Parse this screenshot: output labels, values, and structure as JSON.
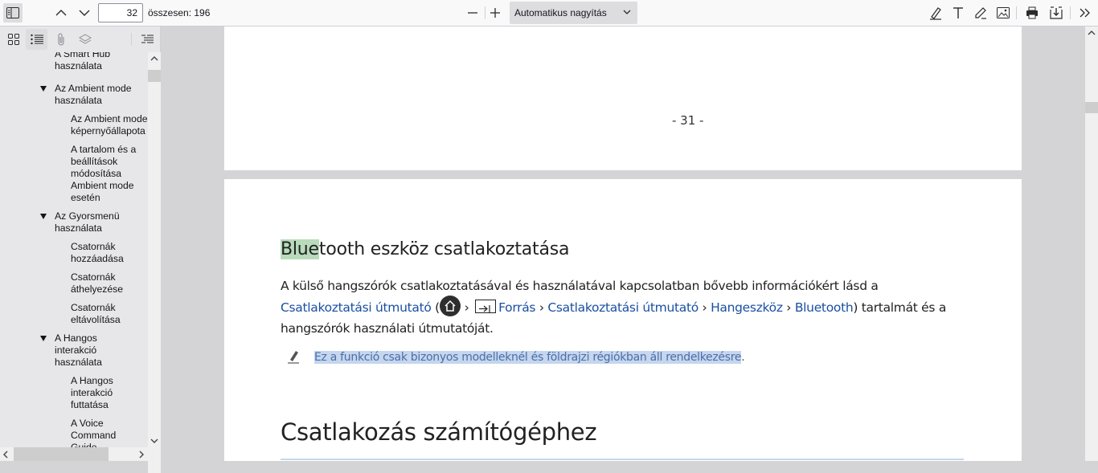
{
  "toolbar": {
    "page_number": "32",
    "page_total": "összesen: 196",
    "zoom_label": "Automatikus nagyítás",
    "icons": [
      "sidebar-toggle-icon",
      "arrow-up-icon",
      "arrow-down-icon",
      "zoom-out-icon",
      "zoom-in-icon",
      "highlight-icon",
      "text-icon",
      "draw-icon",
      "image-icon",
      "print-icon",
      "download-icon",
      "more-tools-icon"
    ]
  },
  "sidebar": {
    "tabs": [
      "thumbnails-icon",
      "outline-icon",
      "attachments-icon",
      "layers-icon",
      "current-outline-icon"
    ],
    "outline": [
      {
        "text": "A Smart Hub\nhasználata",
        "level": 1,
        "toggle": false
      },
      {
        "text": "Az Ambient mode\nhasználata",
        "level": 1,
        "toggle": true
      },
      {
        "text": "Az Ambient mode\nképernyőállapota",
        "level": 2,
        "toggle": false
      },
      {
        "text": "A tartalom és a\nbeállítások\nmódosítása\nAmbient mode\nesetén",
        "level": 2,
        "toggle": false
      },
      {
        "text": "Az Gyorsmenü\nhasználata",
        "level": 1,
        "toggle": true
      },
      {
        "text": "Csatornák\nhozzáadása",
        "level": 2,
        "toggle": false
      },
      {
        "text": "Csatornák\náthelyezése",
        "level": 2,
        "toggle": false
      },
      {
        "text": "Csatornák\neltávolítása",
        "level": 2,
        "toggle": false
      },
      {
        "text": "A Hangos\ninterakció\nhasználata",
        "level": 1,
        "toggle": true
      },
      {
        "text": "A Hangos\ninterakció\nfuttatása",
        "level": 2,
        "toggle": false
      },
      {
        "text": "A Voice\nCommand\nGuide",
        "level": 2,
        "toggle": false
      }
    ]
  },
  "document": {
    "prev_page_number": "- 31 -",
    "section1_title_hl": "Blue",
    "section1_title_rest": "tooth eszköz csatlakoztatása",
    "para_text1": "A külső hangszórók csatlakoztatásával és használatával kapcsolatban bővebb információkért lásd a ",
    "para_link1": "Csatlakoztatási útmutató",
    "para_text2": " (",
    "para_link2": "Forrás",
    "para_link3": "Csatlakoztatási útmutató",
    "para_link4": "Hangeszköz",
    "para_link5": "Bluetooth",
    "para_text3": ") tartalmát és a hangszórók használati útmutatóját.",
    "note_text": "Ez a funkció csak bizonyos modelleknél és földrajzi régiókban áll rendelkezésre",
    "note_period": ".",
    "section2_title": "Csatlakozás számítógéphez"
  },
  "colors": {
    "link": "#1a4fa3",
    "green_highlight": "#b8dbbb",
    "blue_highlight": "#c5d6ee"
  }
}
